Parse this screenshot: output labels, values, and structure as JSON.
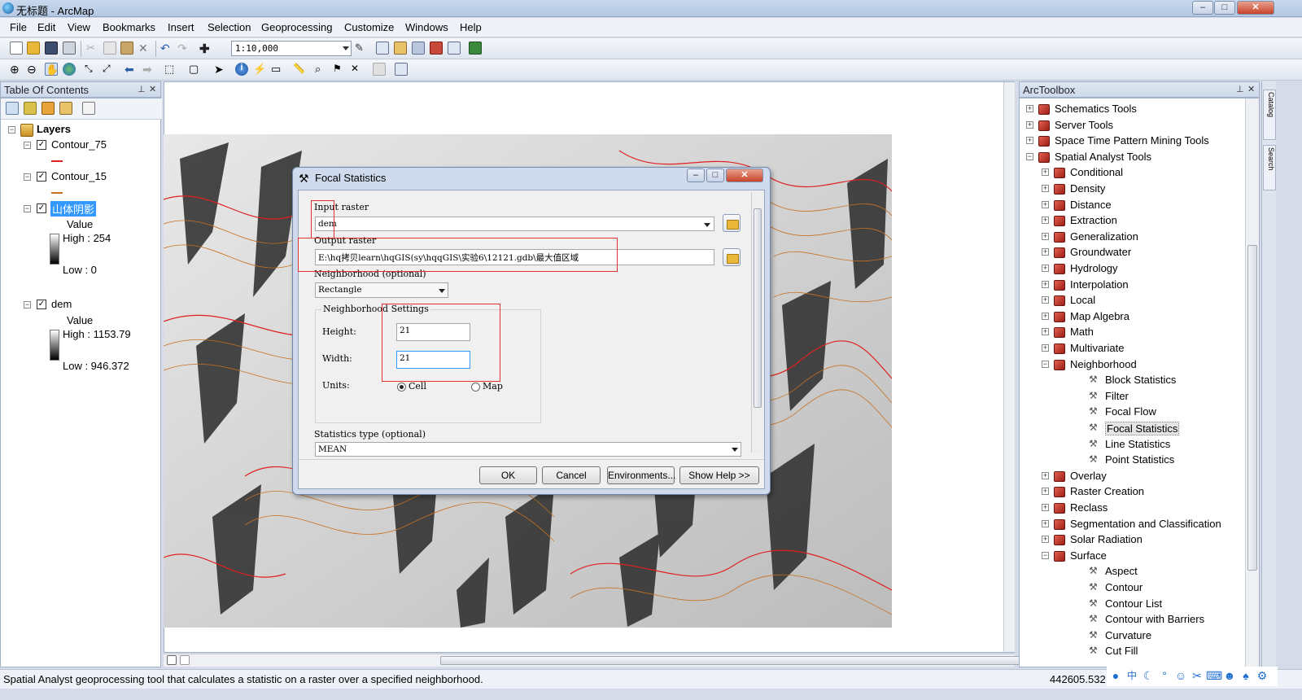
{
  "window": {
    "title": "无标题 - ArcMap",
    "minimize": "–",
    "maximize": "□",
    "close": "✕"
  },
  "menu": [
    "File",
    "Edit",
    "View",
    "Bookmarks",
    "Insert",
    "Selection",
    "Geoprocessing",
    "Customize",
    "Windows",
    "Help"
  ],
  "toolbar": {
    "scale": "1:10,000"
  },
  "toc": {
    "title": "Table Of Contents",
    "root": "Layers",
    "layers": [
      {
        "name": "Contour_75",
        "checked": true,
        "symbol_color": "#e02020"
      },
      {
        "name": "Contour_15",
        "checked": true,
        "symbol_color": "#c87020"
      },
      {
        "name": "山体阴影",
        "checked": true,
        "selected": true,
        "value_label": "Value",
        "high": "High : 254",
        "low": "Low : 0"
      },
      {
        "name": "dem",
        "checked": true,
        "value_label": "Value",
        "high": "High : 1153.79",
        "low": "Low : 946.372"
      }
    ]
  },
  "dialog": {
    "title": "Focal Statistics",
    "input_raster_label": "Input raster",
    "input_raster_value": "dem",
    "output_raster_label": "Output raster",
    "output_raster_value": "E:\\hq拷贝learn\\hqGIS(sy\\hqqGIS\\实验6\\12121.gdb\\最大值区域",
    "neighborhood_label": "Neighborhood (optional)",
    "neighborhood_value": "Rectangle",
    "settings_label": "Neighborhood Settings",
    "height_label": "Height:",
    "height_value": "21",
    "width_label": "Width:",
    "width_value": "21",
    "units_label": "Units:",
    "unit_cell": "Cell",
    "unit_map": "Map",
    "unit_selected": "Cell",
    "stat_type_label": "Statistics type (optional)",
    "stat_type_value": "MEAN",
    "buttons": {
      "ok": "OK",
      "cancel": "Cancel",
      "environments": "Environments...",
      "show_help": "Show Help >>"
    }
  },
  "arctoolbox": {
    "title": "ArcToolbox",
    "items": [
      {
        "label": "Schematics Tools",
        "level": 0,
        "type": "toolbox",
        "expander": "+"
      },
      {
        "label": "Server Tools",
        "level": 0,
        "type": "toolbox",
        "expander": "+"
      },
      {
        "label": "Space Time Pattern Mining Tools",
        "level": 0,
        "type": "toolbox",
        "expander": "+"
      },
      {
        "label": "Spatial Analyst Tools",
        "level": 0,
        "type": "toolbox",
        "expander": "−"
      },
      {
        "label": "Conditional",
        "level": 1,
        "type": "toolbox",
        "expander": "+"
      },
      {
        "label": "Density",
        "level": 1,
        "type": "toolbox",
        "expander": "+"
      },
      {
        "label": "Distance",
        "level": 1,
        "type": "toolbox",
        "expander": "+"
      },
      {
        "label": "Extraction",
        "level": 1,
        "type": "toolbox",
        "expander": "+"
      },
      {
        "label": "Generalization",
        "level": 1,
        "type": "toolbox",
        "expander": "+"
      },
      {
        "label": "Groundwater",
        "level": 1,
        "type": "toolbox",
        "expander": "+"
      },
      {
        "label": "Hydrology",
        "level": 1,
        "type": "toolbox",
        "expander": "+"
      },
      {
        "label": "Interpolation",
        "level": 1,
        "type": "toolbox",
        "expander": "+"
      },
      {
        "label": "Local",
        "level": 1,
        "type": "toolbox",
        "expander": "+"
      },
      {
        "label": "Map Algebra",
        "level": 1,
        "type": "toolbox",
        "expander": "+"
      },
      {
        "label": "Math",
        "level": 1,
        "type": "toolbox",
        "expander": "+"
      },
      {
        "label": "Multivariate",
        "level": 1,
        "type": "toolbox",
        "expander": "+"
      },
      {
        "label": "Neighborhood",
        "level": 1,
        "type": "toolbox",
        "expander": "−"
      },
      {
        "label": "Block Statistics",
        "level": 2,
        "type": "tool"
      },
      {
        "label": "Filter",
        "level": 2,
        "type": "tool"
      },
      {
        "label": "Focal Flow",
        "level": 2,
        "type": "tool"
      },
      {
        "label": "Focal Statistics",
        "level": 2,
        "type": "tool",
        "selected": true
      },
      {
        "label": "Line Statistics",
        "level": 2,
        "type": "tool"
      },
      {
        "label": "Point Statistics",
        "level": 2,
        "type": "tool"
      },
      {
        "label": "Overlay",
        "level": 1,
        "type": "toolbox",
        "expander": "+"
      },
      {
        "label": "Raster Creation",
        "level": 1,
        "type": "toolbox",
        "expander": "+"
      },
      {
        "label": "Reclass",
        "level": 1,
        "type": "toolbox",
        "expander": "+"
      },
      {
        "label": "Segmentation and Classification",
        "level": 1,
        "type": "toolbox",
        "expander": "+"
      },
      {
        "label": "Solar Radiation",
        "level": 1,
        "type": "toolbox",
        "expander": "+"
      },
      {
        "label": "Surface",
        "level": 1,
        "type": "toolbox",
        "expander": "−"
      },
      {
        "label": "Aspect",
        "level": 2,
        "type": "tool"
      },
      {
        "label": "Contour",
        "level": 2,
        "type": "tool"
      },
      {
        "label": "Contour List",
        "level": 2,
        "type": "tool"
      },
      {
        "label": "Contour with Barriers",
        "level": 2,
        "type": "tool"
      },
      {
        "label": "Curvature",
        "level": 2,
        "type": "tool"
      },
      {
        "label": "Cut Fill",
        "level": 2,
        "type": "tool"
      }
    ]
  },
  "side_tabs": [
    "Catalog",
    "Search"
  ],
  "status": {
    "message": "Spatial Analyst geoprocessing tool that calculates a statistic on a raster over a specified neighborhood.",
    "coords": "442605.532"
  }
}
